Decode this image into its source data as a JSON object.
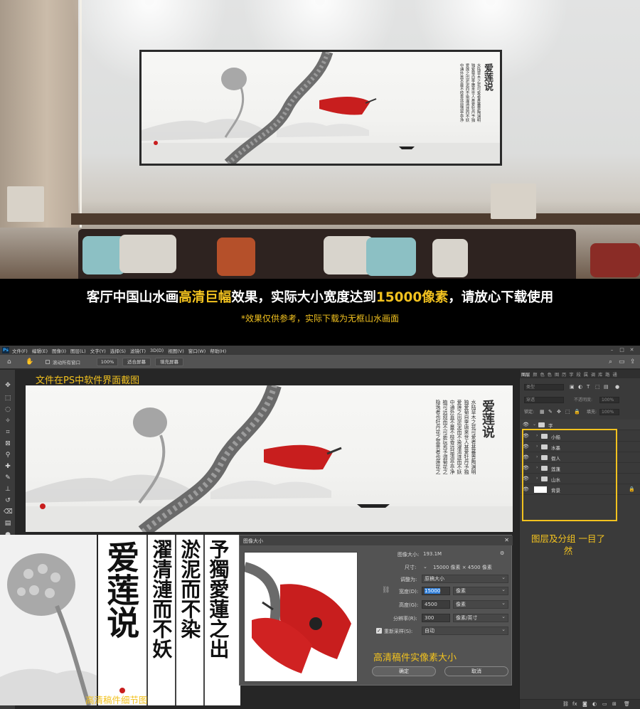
{
  "banner": {
    "headline_1": "客厅中国山水画",
    "headline_hl1": "高清巨幅",
    "headline_2": "效果，实际大小宽度达到",
    "headline_hl2": "15000像素",
    "headline_3": "，请放心下载使用",
    "subnote": "*效果仅供参考，实际下载为无框山水画面"
  },
  "painting": {
    "title": "爱莲说",
    "columns": [
      "水陆草木之花可爱者甚蕃晋陶渊明",
      "独爱菊自李唐来世人甚爱牡丹予独",
      "爱莲之出淤泥而不染濯清涟而不妖",
      "中通外直不蔓不枝香远益清亭亭净",
      "植可远观而不可亵玩焉予谓菊花之",
      "隐逸者也牡丹花之富贵者也莲花之"
    ]
  },
  "menubar": {
    "items": [
      "文件(F)",
      "编辑(E)",
      "图像(I)",
      "图层(L)",
      "文字(Y)",
      "选择(S)",
      "滤镜(T)",
      "3D(D)",
      "视图(V)",
      "窗口(W)",
      "帮助(H)"
    ]
  },
  "optbar": {
    "scroll_all": "滚动所有窗口",
    "zoom": "100%",
    "fit_screen": "适合屏幕",
    "fill_screen": "填充屏幕"
  },
  "labels": {
    "canvas_label": "文件在PS中软件界面截图",
    "detail_label": "高清稿件细节图",
    "dialog_note": "高清稿件实像素大小",
    "layer_note": "图层及分组 一目了然"
  },
  "detail": {
    "title_chars": "爱莲说",
    "col1": "濯清漣而不妖",
    "col2": "淤泥而不染",
    "col3": "予獨愛蓮之出"
  },
  "dialog": {
    "title": "图像大小",
    "image_size_label": "图像大小:",
    "image_size_value": "193.1M",
    "dimensions_label": "尺寸:",
    "dimensions_value": "15000 像素  ×  4500 像素",
    "fit_label": "调整为:",
    "fit_value": "原稿大小",
    "width_label": "宽度(D):",
    "width_value": "15000",
    "width_unit": "像素",
    "height_label": "高度(G):",
    "height_value": "4500",
    "height_unit": "像素",
    "resolution_label": "分辨率(R):",
    "resolution_value": "300",
    "resolution_unit": "像素/英寸",
    "resample_label": "重新采样(S):",
    "resample_value": "自动",
    "ok": "确定",
    "cancel": "取消"
  },
  "layers_panel": {
    "tabs": [
      "图层",
      "颜",
      "色",
      "色",
      "图",
      "历",
      "字",
      "段",
      "属",
      "调",
      "库",
      "路",
      "通"
    ],
    "filter_kind": "类型",
    "blend_mode": "穿透",
    "opacity_label": "不透明度:",
    "opacity_value": "100%",
    "lock_label": "锁定:",
    "fill_label": "填充:",
    "fill_value": "100%",
    "layers": [
      {
        "name": "字",
        "type": "group",
        "level": 0
      },
      {
        "name": "小船",
        "type": "group",
        "level": 1
      },
      {
        "name": "水墨",
        "type": "group",
        "level": 1
      },
      {
        "name": "假人",
        "type": "group",
        "level": 1
      },
      {
        "name": "莲蓬",
        "type": "group",
        "level": 1
      },
      {
        "name": "山水",
        "type": "group",
        "level": 1
      },
      {
        "name": "背景",
        "type": "layer",
        "level": 0
      }
    ]
  },
  "colors": {
    "accent_yellow": "#f2c21f",
    "ps_bg": "#282828",
    "ps_panel": "#3a3a3a",
    "ink_red": "#c81e1e"
  }
}
